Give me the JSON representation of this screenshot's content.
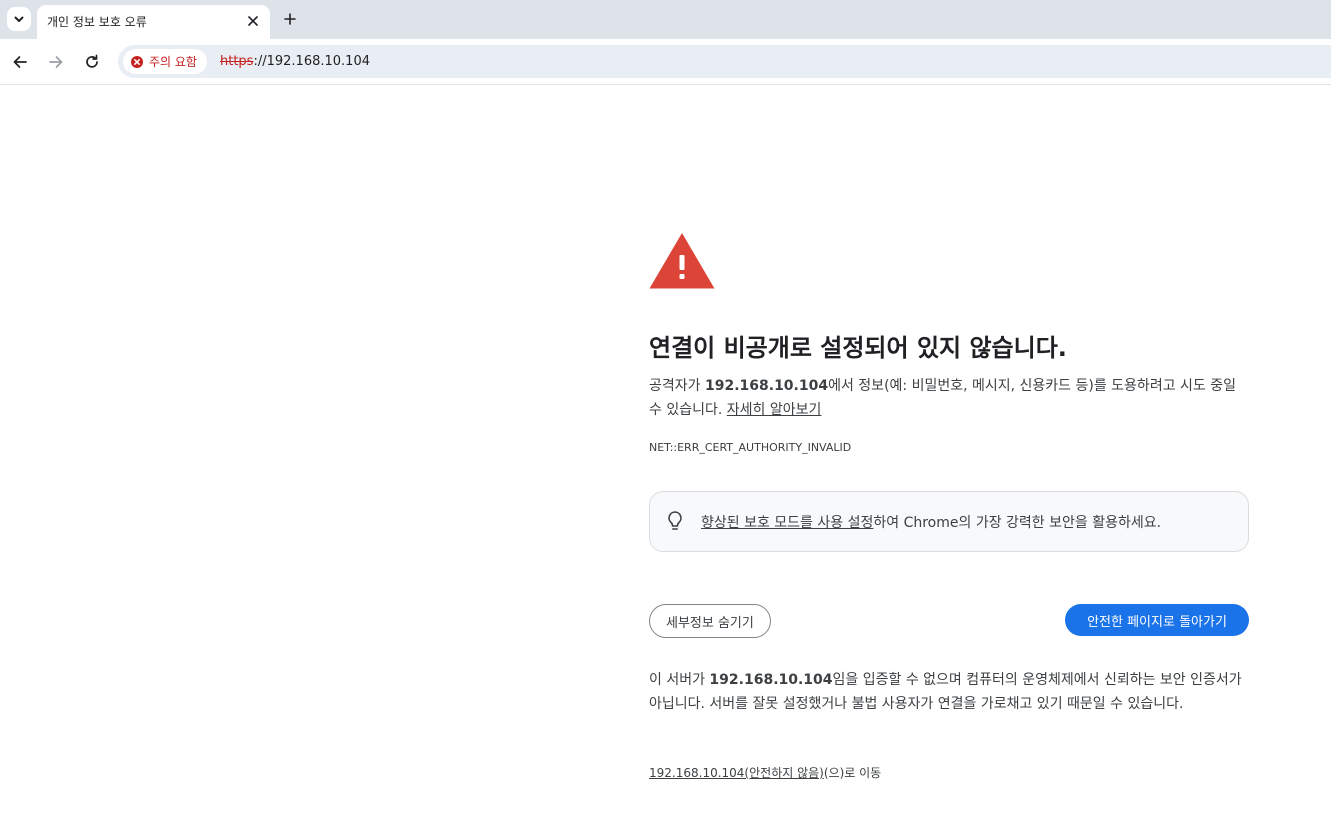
{
  "tab": {
    "title": "개인 정보 보호 오류"
  },
  "omnibox": {
    "warning_label": "주의 요함",
    "url_scheme": "https",
    "url_rest": "://192.168.10.104"
  },
  "interstitial": {
    "heading": "연결이 비공개로 설정되어 있지 않습니다.",
    "explanation_prefix": "공격자가 ",
    "explanation_host": "192.168.10.104",
    "explanation_suffix": "에서 정보(예: 비밀번호, 메시지, 신용카드 등)를 도용하려고 시도 중일 수 있습니다. ",
    "learn_more_link": "자세히 알아보기",
    "error_code": "NET::ERR_CERT_AUTHORITY_INVALID",
    "promo_link": "향상된 보호 모드를 사용 설정",
    "promo_suffix": "하여 Chrome의 가장 강력한 보안을 활용하세요.",
    "details_button": "세부정보 숨기기",
    "back_button": "안전한 페이지로 돌아가기",
    "details_prefix": "이 서버가 ",
    "details_host": "192.168.10.104",
    "details_suffix": "임을 입증할 수 없으며 컴퓨터의 운영체제에서 신뢰하는 보안 인증서가 아닙니다. 서버를 잘못 설정했거나 불법 사용자가 연결을 가로채고 있기 때문일 수 있습니다.",
    "proceed_link": "192.168.10.104(안전하지 않음)",
    "proceed_suffix": "(으)로 이동"
  },
  "colors": {
    "warning_red": "#db4437",
    "primary_blue": "#1a73e8",
    "danger_text": "#c5221f"
  },
  "icons": {
    "tab_search": "chevron-down-icon",
    "tab_close": "close-icon",
    "new_tab": "plus-icon",
    "back": "arrow-left-icon",
    "forward": "arrow-right-icon",
    "reload": "reload-icon",
    "warning_chip": "error-circle-icon",
    "hero": "warning-triangle-icon",
    "promo": "lightbulb-icon"
  }
}
